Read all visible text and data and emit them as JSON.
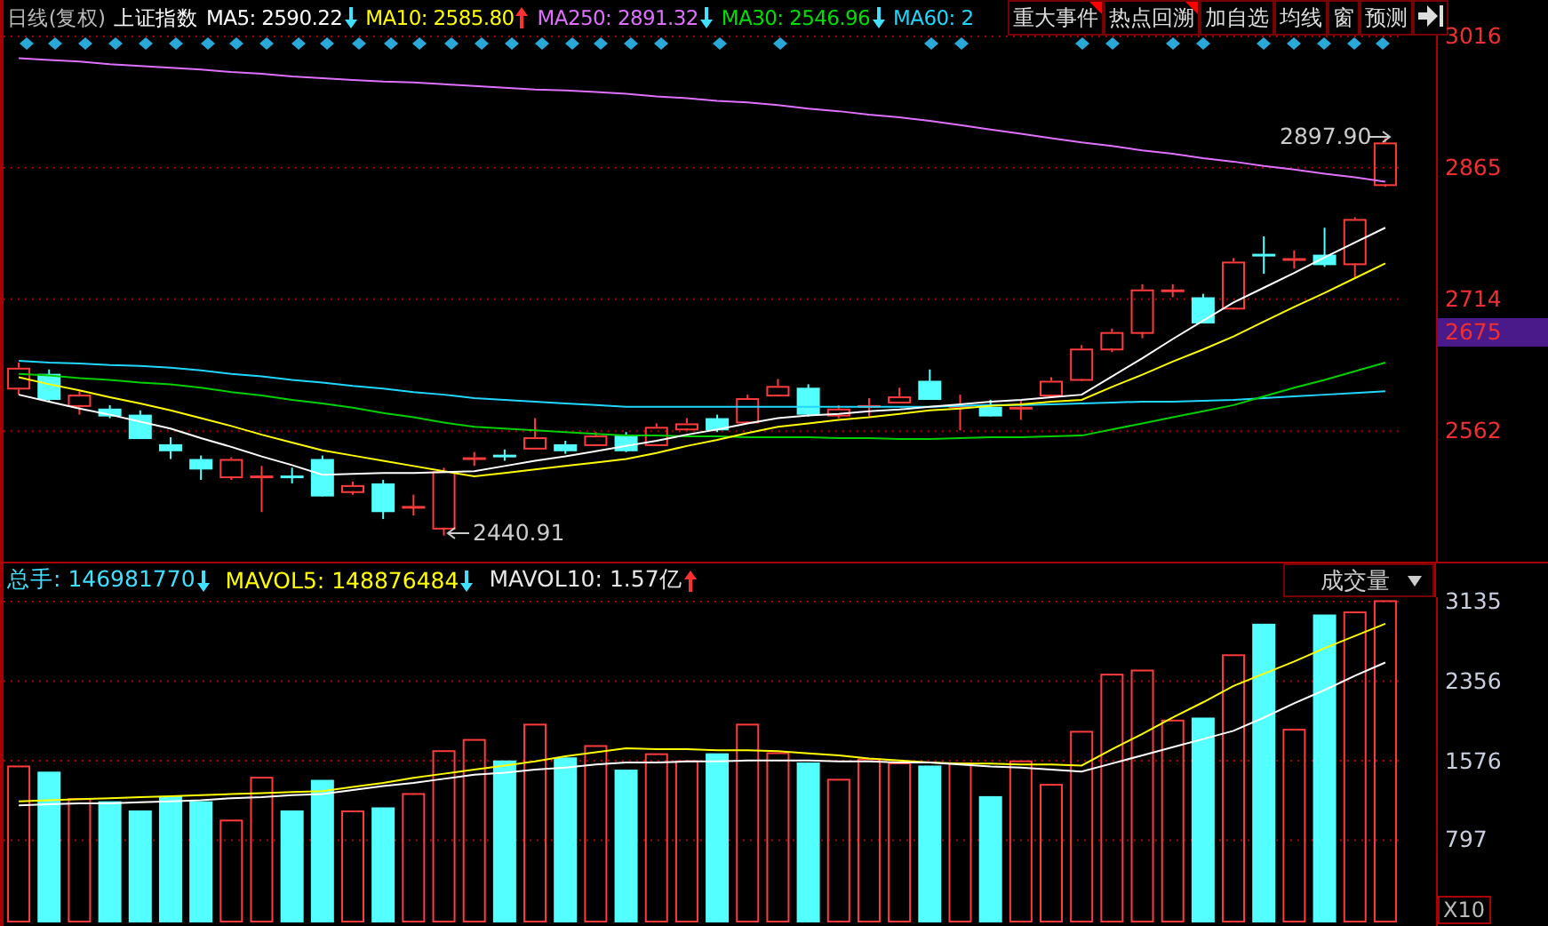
{
  "header": {
    "period": "日线(复权)",
    "index_name": "上证指数",
    "indicators": [
      {
        "label": "MA5:",
        "value": "2590.22",
        "rising": false,
        "color": "#ffffff"
      },
      {
        "label": "MA10:",
        "value": "2585.80",
        "rising": true,
        "color": "#ffff00"
      },
      {
        "label": "MA250:",
        "value": "2891.32",
        "rising": false,
        "color": "#e070ff"
      },
      {
        "label": "MA30:",
        "value": "2546.96",
        "rising": false,
        "color": "#00e000"
      },
      {
        "label": "MA60:",
        "value": "2",
        "color": "#20d8ff"
      }
    ],
    "buttons": [
      {
        "label": "重大事件",
        "flagged": true
      },
      {
        "label": "热点回溯",
        "flagged": true
      },
      {
        "label": "加自选",
        "flagged": false
      },
      {
        "label": "均线",
        "flagged": false
      },
      {
        "label": "窗",
        "flagged": false
      },
      {
        "label": "预测",
        "flagged": false
      }
    ]
  },
  "price_chart": {
    "high_label": "2897.90",
    "low_label": "2440.91",
    "current": "2675",
    "chart_data": {
      "type": "candlestick",
      "grid": true,
      "ylim": [
        2411,
        3016
      ],
      "yticks": [
        3016,
        2865,
        2714,
        2562
      ],
      "ohlc": [
        [
          2611,
          2640,
          2603,
          2634
        ],
        [
          2627,
          2632,
          2595,
          2599
        ],
        [
          2591,
          2607,
          2580,
          2603
        ],
        [
          2587,
          2591,
          2576,
          2580
        ],
        [
          2580,
          2585,
          2552,
          2554
        ],
        [
          2546,
          2554,
          2529,
          2540
        ],
        [
          2529,
          2533,
          2505,
          2519
        ],
        [
          2509,
          2531,
          2505,
          2529
        ],
        [
          2509,
          2521,
          2468,
          2510
        ],
        [
          2510,
          2519,
          2501,
          2509
        ],
        [
          2529,
          2533,
          2486,
          2488
        ],
        [
          2492,
          2503,
          2488,
          2499
        ],
        [
          2501,
          2505,
          2460,
          2470
        ],
        [
          2474,
          2488,
          2464,
          2475
        ],
        [
          2450,
          2519,
          2441,
          2515
        ],
        [
          2530,
          2537,
          2521,
          2531
        ],
        [
          2534,
          2540,
          2527,
          2533
        ],
        [
          2542,
          2576,
          2542,
          2554
        ],
        [
          2546,
          2550,
          2535,
          2540
        ],
        [
          2546,
          2560,
          2544,
          2556
        ],
        [
          2556,
          2560,
          2537,
          2540
        ],
        [
          2546,
          2570,
          2544,
          2566
        ],
        [
          2564,
          2576,
          2562,
          2570
        ],
        [
          2576,
          2580,
          2560,
          2564
        ],
        [
          2572,
          2603,
          2570,
          2599
        ],
        [
          2603,
          2621,
          2601,
          2613
        ],
        [
          2611,
          2615,
          2578,
          2582
        ],
        [
          2580,
          2591,
          2576,
          2587
        ],
        [
          2590,
          2599,
          2578,
          2591
        ],
        [
          2595,
          2611,
          2593,
          2601
        ],
        [
          2619,
          2632,
          2597,
          2599
        ],
        [
          2590,
          2603,
          2562,
          2591
        ],
        [
          2589,
          2597,
          2578,
          2580
        ],
        [
          2588,
          2597,
          2574,
          2589
        ],
        [
          2603,
          2623,
          2601,
          2619
        ],
        [
          2621,
          2660,
          2619,
          2656
        ],
        [
          2656,
          2679,
          2652,
          2675
        ],
        [
          2675,
          2730,
          2668,
          2724
        ],
        [
          2723,
          2730,
          2715,
          2724
        ],
        [
          2715,
          2719,
          2685,
          2687
        ],
        [
          2703,
          2760,
          2701,
          2756
        ],
        [
          2765,
          2785,
          2742,
          2764
        ],
        [
          2759,
          2769,
          2748,
          2760
        ],
        [
          2764,
          2795,
          2750,
          2754
        ],
        [
          2754,
          2807,
          2738,
          2805
        ],
        [
          2845,
          2898,
          2842,
          2893
        ]
      ],
      "series": [
        {
          "type": "line",
          "color": "#e070ff",
          "values": [
            2990,
            2988,
            2986,
            2983,
            2981,
            2979,
            2977,
            2974,
            2972,
            2969,
            2967,
            2965,
            2963,
            2962,
            2960,
            2958,
            2956,
            2954,
            2953,
            2951,
            2949,
            2946,
            2944,
            2941,
            2939,
            2936,
            2932,
            2929,
            2925,
            2922,
            2918,
            2913,
            2908,
            2903,
            2898,
            2893,
            2889,
            2884,
            2880,
            2875,
            2871,
            2866,
            2862,
            2857,
            2853,
            2848
          ]
        },
        {
          "type": "line",
          "color": "#20d8ff",
          "values": [
            2642,
            2640,
            2639,
            2637,
            2636,
            2634,
            2631,
            2627,
            2624,
            2620,
            2617,
            2613,
            2610,
            2606,
            2603,
            2599,
            2597,
            2595,
            2593,
            2591,
            2589,
            2589,
            2589,
            2589,
            2589,
            2589,
            2589,
            2589,
            2589,
            2589,
            2589,
            2590,
            2591,
            2591,
            2592,
            2593,
            2594,
            2595,
            2595,
            2596,
            2597,
            2599,
            2601,
            2603,
            2605,
            2607
          ]
        },
        {
          "type": "line",
          "color": "#00d000",
          "values": [
            2627,
            2625,
            2622,
            2620,
            2617,
            2615,
            2611,
            2606,
            2602,
            2597,
            2593,
            2588,
            2582,
            2577,
            2571,
            2566,
            2564,
            2562,
            2560,
            2558,
            2556,
            2556,
            2555,
            2555,
            2554,
            2554,
            2554,
            2553,
            2553,
            2552,
            2552,
            2553,
            2554,
            2554,
            2555,
            2556,
            2563,
            2570,
            2577,
            2584,
            2591,
            2601,
            2611,
            2620,
            2630,
            2640
          ]
        },
        {
          "type": "line",
          "color": "#ffff00",
          "values": [
            2623,
            2615,
            2608,
            2600,
            2593,
            2585,
            2576,
            2567,
            2557,
            2548,
            2539,
            2533,
            2527,
            2521,
            2515,
            2509,
            2513,
            2517,
            2521,
            2525,
            2529,
            2536,
            2544,
            2551,
            2559,
            2566,
            2570,
            2574,
            2577,
            2581,
            2585,
            2587,
            2590,
            2592,
            2595,
            2597,
            2612,
            2626,
            2641,
            2655,
            2670,
            2687,
            2704,
            2720,
            2737,
            2754
          ]
        },
        {
          "type": "line",
          "color": "#ffffff",
          "values": [
            2603,
            2595,
            2587,
            2580,
            2572,
            2564,
            2553,
            2543,
            2532,
            2522,
            2511,
            2512,
            2513,
            2513,
            2514,
            2515,
            2521,
            2527,
            2532,
            2538,
            2544,
            2550,
            2557,
            2563,
            2570,
            2576,
            2579,
            2581,
            2584,
            2586,
            2589,
            2592,
            2595,
            2597,
            2600,
            2603,
            2624,
            2645,
            2667,
            2688,
            2709,
            2726,
            2743,
            2761,
            2778,
            2795
          ]
        }
      ]
    }
  },
  "volume_header": {
    "indicators": [
      {
        "label": "总手:",
        "value": "146981770",
        "rising": false,
        "color": "#40e0ff"
      },
      {
        "label": "MAVOL5:",
        "value": "148876484",
        "rising": false,
        "color": "#ffff00"
      },
      {
        "label": "MAVOL10:",
        "value": "1.57亿",
        "rising": true,
        "color": "#e8e8e8"
      }
    ],
    "selector": "成交量"
  },
  "volume_chart": {
    "unit": "X10",
    "chart_data": {
      "type": "bar",
      "grid": true,
      "ylim": [
        -70,
        3170
      ],
      "yticks": [
        3135,
        2356,
        1576,
        797
      ],
      "series": [
        {
          "color": "#54ffff",
          "values": [
            null,
            1460,
            null,
            1170,
            1080,
            1220,
            1170,
            null,
            null,
            1080,
            1380,
            null,
            1110,
            null,
            null,
            null,
            1570,
            null,
            1600,
            null,
            1480,
            null,
            null,
            1640,
            null,
            null,
            1550,
            null,
            null,
            null,
            1520,
            null,
            1220,
            null,
            null,
            null,
            null,
            null,
            null,
            1990,
            null,
            2910,
            null,
            3000,
            null,
            null
          ]
        },
        {
          "color": "#ff3c3c",
          "values": [
            1520,
            null,
            1200,
            null,
            null,
            null,
            null,
            990,
            1410,
            null,
            null,
            1080,
            null,
            1250,
            1670,
            1780,
            null,
            1930,
            null,
            1720,
            null,
            1640,
            1570,
            null,
            1930,
            1650,
            null,
            1390,
            1590,
            1550,
            null,
            1550,
            null,
            1570,
            1340,
            1860,
            2420,
            2460,
            1970,
            null,
            2610,
            null,
            1880,
            null,
            3030,
            3140
          ]
        },
        {
          "type": "line",
          "color": "#ffff00",
          "values": [
            1170,
            1180,
            1190,
            1200,
            1210,
            1220,
            1230,
            1240,
            1250,
            1260,
            1270,
            1310,
            1350,
            1400,
            1440,
            1480,
            1520,
            1560,
            1610,
            1650,
            1690,
            1680,
            1680,
            1670,
            1670,
            1660,
            1640,
            1620,
            1590,
            1570,
            1550,
            1540,
            1540,
            1530,
            1530,
            1520,
            1680,
            1830,
            1990,
            2140,
            2300,
            2420,
            2540,
            2670,
            2790,
            2910
          ]
        },
        {
          "type": "line",
          "color": "#ffffff",
          "values": [
            1130,
            1140,
            1150,
            1150,
            1160,
            1170,
            1180,
            1200,
            1210,
            1230,
            1240,
            1280,
            1320,
            1350,
            1390,
            1430,
            1450,
            1480,
            1500,
            1530,
            1550,
            1550,
            1560,
            1560,
            1570,
            1570,
            1570,
            1560,
            1560,
            1550,
            1550,
            1530,
            1510,
            1500,
            1480,
            1460,
            1540,
            1620,
            1700,
            1780,
            1860,
            1990,
            2130,
            2260,
            2400,
            2530
          ]
        }
      ]
    }
  }
}
